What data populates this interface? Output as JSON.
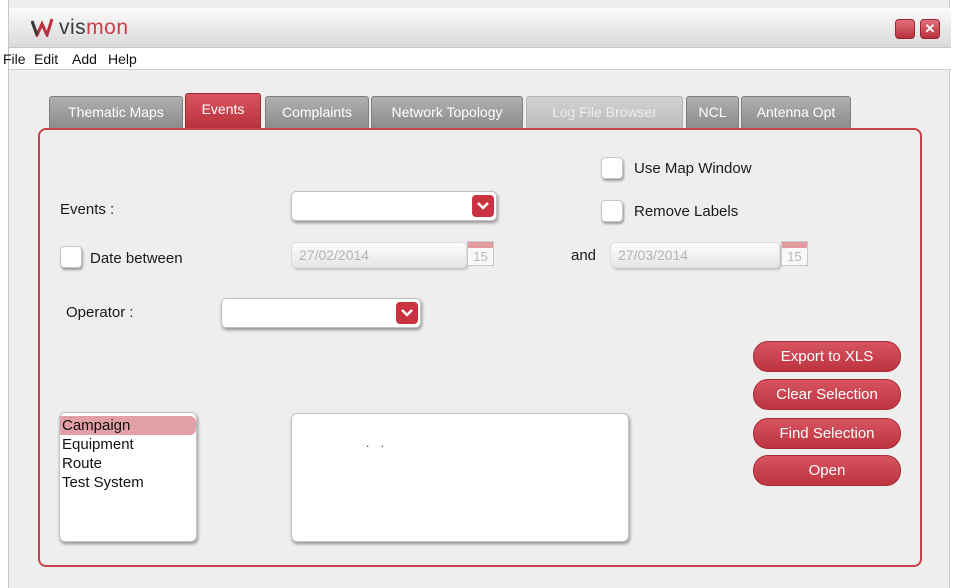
{
  "app": {
    "name_part1": "vis",
    "name_part2": "mon",
    "minimize_label": "",
    "close_label": "✕"
  },
  "menu": [
    "File",
    "Edit",
    "Add",
    "Help"
  ],
  "tabs": [
    {
      "label": "Thematic Maps",
      "state": "normal"
    },
    {
      "label": "Events",
      "state": "active"
    },
    {
      "label": "Complaints",
      "state": "normal"
    },
    {
      "label": "Network Topology",
      "state": "normal"
    },
    {
      "label": "Log File Browser",
      "state": "disabled"
    },
    {
      "label": "NCL",
      "state": "normal"
    },
    {
      "label": "Antenna Opt",
      "state": "normal"
    }
  ],
  "form": {
    "use_map_window_label": "Use Map Window",
    "remove_labels_label": "Remove Labels",
    "events_label": "Events :",
    "events_value": "",
    "date_between_label": "Date between",
    "date_from": "27/02/2014",
    "and_label": "and",
    "date_to": "27/03/2014",
    "calendar_day": "15",
    "operator_label": "Operator :",
    "operator_value": ""
  },
  "buttons": {
    "export": "Export to XLS",
    "clear": "Clear Selection",
    "find": "Find Selection",
    "open": "Open"
  },
  "list": {
    "items": [
      "Campaign",
      "Equipment",
      "Route",
      "Test System"
    ],
    "selected_index": 0
  },
  "results_text": ". .",
  "colors": {
    "accent": "#c8333f",
    "tab_inactive": "#9a9a9a",
    "panel_border": "#c9414c"
  }
}
